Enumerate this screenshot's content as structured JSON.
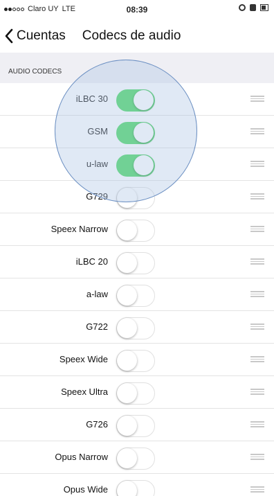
{
  "status_bar": {
    "carrier": "Claro UY",
    "network": "LTE",
    "time": "08:39"
  },
  "nav": {
    "back_label": "Cuentas",
    "title": "Codecs de audio"
  },
  "section": {
    "header": "AUDIO CODECS"
  },
  "codecs": [
    {
      "label": "iLBC 30",
      "enabled": true
    },
    {
      "label": "GSM",
      "enabled": true
    },
    {
      "label": "u-law",
      "enabled": true
    },
    {
      "label": "G729",
      "enabled": false
    },
    {
      "label": "Speex Narrow",
      "enabled": false
    },
    {
      "label": "iLBC 20",
      "enabled": false
    },
    {
      "label": "a-law",
      "enabled": false
    },
    {
      "label": "G722",
      "enabled": false
    },
    {
      "label": "Speex Wide",
      "enabled": false
    },
    {
      "label": "Speex Ultra",
      "enabled": false
    },
    {
      "label": "G726",
      "enabled": false
    },
    {
      "label": "Opus Narrow",
      "enabled": false
    },
    {
      "label": "Opus Wide",
      "enabled": false
    }
  ],
  "colors": {
    "toggle_on": "#4cd964",
    "section_bg": "#efeff4",
    "touch_highlight": "#adc4e4"
  }
}
